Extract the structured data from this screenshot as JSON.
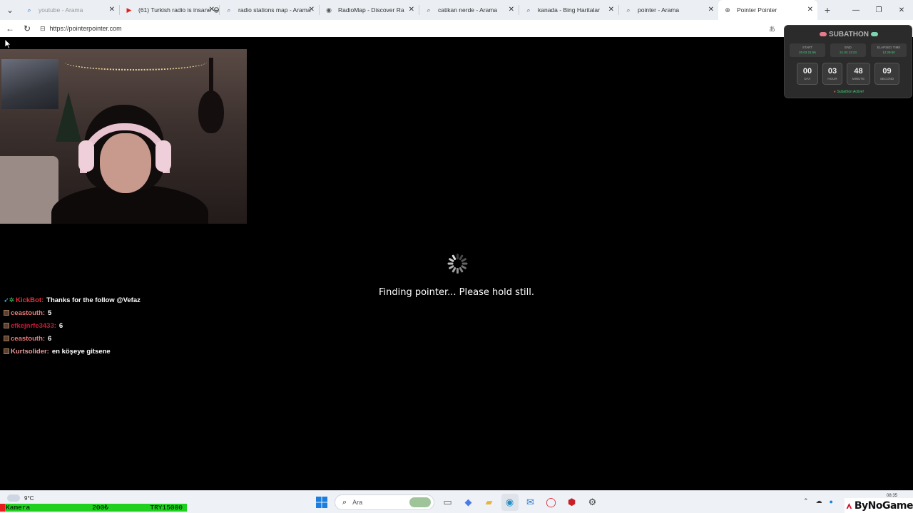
{
  "browser": {
    "tabs": [
      {
        "title": "youtube - Arama",
        "icon": "search-icon",
        "faded": true
      },
      {
        "title": "(61) Turkish radio is insane 😂",
        "icon": "youtube-icon",
        "faded": false
      },
      {
        "title": "radio stations map - Arama",
        "icon": "search-icon",
        "faded": false
      },
      {
        "title": "RadioMap - Discover Ra",
        "icon": "radio-icon",
        "faded": false
      },
      {
        "title": "catikan nerde - Arama",
        "icon": "search-icon",
        "faded": false
      },
      {
        "title": "kanada - Bing Haritalar",
        "icon": "search-icon",
        "faded": false
      },
      {
        "title": "pointer - Arama",
        "icon": "search-icon",
        "faded": false
      },
      {
        "title": "Pointer Pointer",
        "icon": "globe-icon",
        "faded": false,
        "active": true
      }
    ],
    "url": "https://pointerpointer.com"
  },
  "page": {
    "status_text": "Finding pointer... Please hold still."
  },
  "chat": [
    {
      "user": "KickBot:",
      "message": "Thanks for the follow @Vefaz",
      "user_color": "#e8303c",
      "bot": true
    },
    {
      "user": "ceastouth:",
      "message": "5",
      "user_color": "#f07a7a",
      "bot": false
    },
    {
      "user": "efkejnrfe3433:",
      "message": "6",
      "user_color": "#d01838",
      "bot": false
    },
    {
      "user": "ceastouth:",
      "message": "6",
      "user_color": "#f07a7a",
      "bot": false
    },
    {
      "user": "Kurtsolider:",
      "message": "en köşeye gitsene",
      "user_color": "#ef9c9c",
      "bot": false
    }
  ],
  "subathon": {
    "title": "SUBATHON",
    "start_label": "START",
    "start_value": "20.03 21:56",
    "end_label": "END",
    "end_value": "21.03 13:23",
    "elapsed_label": "ELAPSED TIME",
    "elapsed_value": "12:29:50",
    "countdown": [
      {
        "value": "00",
        "unit": "DAY"
      },
      {
        "value": "03",
        "unit": "HOUR"
      },
      {
        "value": "48",
        "unit": "MINUTE"
      },
      {
        "value": "09",
        "unit": "SECOND"
      }
    ],
    "status": "Subathon Active!",
    "pad_colors": [
      "#e87b8a",
      "#7bd6b0"
    ]
  },
  "taskbar": {
    "temperature": "9°C",
    "search_placeholder": "Ara",
    "clock": "08:35"
  },
  "overlay": {
    "camera_label": "Kamera",
    "amount": "200₺",
    "target": "TRY15000",
    "brand": "ByNoGame"
  },
  "colors": {
    "accent_green": "#3fd07a",
    "camera_bar": "#1fd01f"
  }
}
